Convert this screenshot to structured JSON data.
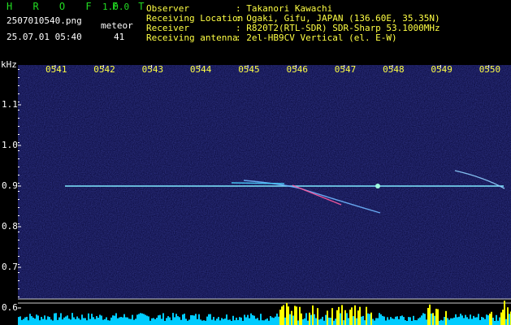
{
  "header": {
    "app_name": "H R O F F T",
    "version": "1.0.0",
    "filename": "2507010540.png",
    "datetime": "25.07.01 05:40",
    "meteor_label": "meteor",
    "meteor_count": "41"
  },
  "station": {
    "rows": [
      {
        "label": "Observer",
        "value": ": Takanori Kawachi"
      },
      {
        "label": "Receiving Location",
        "value": ": Ogaki, Gifu, JAPAN (136.60E, 35.35N)"
      },
      {
        "label": "Receiver",
        "value": ": R820T2(RTL-SDR) SDR-Sharp 53.1000MHz"
      },
      {
        "label": "Receiving antenna",
        "value": ": 2el-HB9CV Vertical (el. E-W)"
      }
    ]
  },
  "chart_data": {
    "type": "heatmap",
    "ylabel": "kHz",
    "y_ticks": [
      "1.1",
      "1.0",
      "0.9",
      "0.8",
      "0.7",
      "0.6"
    ],
    "x_ticks": [
      "0541",
      "0542",
      "0543",
      "0544",
      "0545",
      "0546",
      "0547",
      "0548",
      "0549",
      "0550"
    ],
    "xlim": [
      "05:40",
      "05:50"
    ],
    "ylim": [
      0.6,
      1.15
    ],
    "carrier_khz": 0.9,
    "colors": {
      "background": "#0a0a3c",
      "carrier": "#7fe8ff",
      "tick_text": "#ffff44",
      "bars": "#00ccff",
      "bars_peak": "#ffff00"
    }
  }
}
